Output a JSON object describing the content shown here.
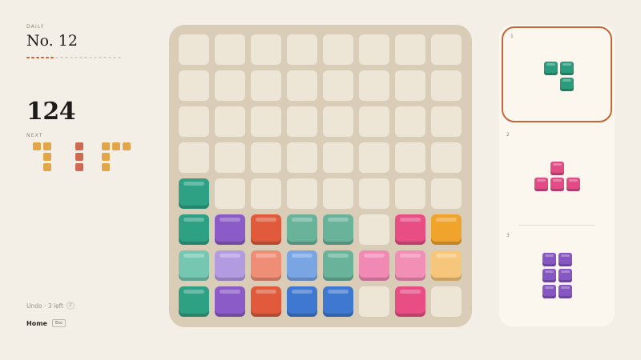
{
  "header": {
    "daily_label": "DAILY",
    "puzzle_title": "No. 12",
    "progress": {
      "filled": 6,
      "total": 20,
      "filled_color": "#d0623a",
      "empty_color": "#dcd3c7"
    }
  },
  "score": "124",
  "next": {
    "label": "NEXT",
    "pieces": [
      {
        "color": "#e2a548",
        "cells": [
          [
            0,
            0
          ],
          [
            1,
            0
          ],
          [
            1,
            1
          ],
          [
            1,
            2
          ]
        ]
      },
      {
        "color": "#cf6a52",
        "cells": [
          [
            0,
            0
          ],
          [
            0,
            1
          ],
          [
            0,
            2
          ]
        ]
      },
      {
        "color": "#e2a548",
        "cells": [
          [
            0,
            0
          ],
          [
            1,
            0
          ],
          [
            2,
            0
          ],
          [
            0,
            1
          ],
          [
            0,
            2
          ]
        ]
      }
    ]
  },
  "undo": {
    "label": "Undo · 3 left",
    "key": "Z"
  },
  "home": {
    "label": "Home",
    "key": "Esc"
  },
  "colors": {
    "teal": "#2ea184",
    "purple": "#8b5bc7",
    "red": "#e05a3b",
    "green_muted": "#6ab39b",
    "pink": "#e84d84",
    "orange": "#f0a42c",
    "teal_light": "#76c7b1",
    "purple_light": "#b39be0",
    "salmon": "#ee8e76",
    "blue_light": "#7aa5e3",
    "pink_light": "#f089b3",
    "pink_soft": "#f28fb5",
    "orange_light": "#f6c67c",
    "blue": "#3e78d1",
    "tray_teal": "#2a9b7d",
    "tray_pink": "#e24b86",
    "tray_purple": "#8656c2",
    "accent": "#c4663a"
  },
  "board": {
    "rows": [
      [
        "empty",
        "empty",
        "empty",
        "empty",
        "empty",
        "empty",
        "empty",
        "empty"
      ],
      [
        "empty",
        "empty",
        "empty",
        "empty",
        "empty",
        "empty",
        "empty",
        "empty"
      ],
      [
        "empty",
        "empty",
        "empty",
        "empty",
        "empty",
        "empty",
        "empty",
        "empty"
      ],
      [
        "empty",
        "empty",
        "empty",
        "empty",
        "empty",
        "empty",
        "empty",
        "empty"
      ],
      [
        "teal",
        "empty",
        "empty",
        "empty",
        "empty",
        "empty",
        "empty",
        "empty"
      ],
      [
        "teal",
        "purple",
        "red",
        "green_muted",
        "green_muted",
        "empty",
        "pink",
        "orange"
      ],
      [
        "teal_light",
        "purple_light",
        "salmon",
        "blue_light",
        "green_muted",
        "pink_light",
        "pink_soft",
        "orange_light"
      ],
      [
        "teal",
        "purple",
        "red",
        "blue",
        "blue",
        "empty",
        "pink",
        "empty"
      ]
    ]
  },
  "tray": {
    "slots": [
      {
        "number": "1",
        "selected": true,
        "color": "tray_teal",
        "cells": [
          [
            0,
            0
          ],
          [
            1,
            0
          ],
          [
            1,
            1
          ]
        ]
      },
      {
        "number": "2",
        "selected": false,
        "color": "tray_pink",
        "cells": [
          [
            1,
            0
          ],
          [
            0,
            1
          ],
          [
            1,
            1
          ],
          [
            2,
            1
          ]
        ]
      },
      {
        "number": "3",
        "selected": false,
        "color": "tray_purple",
        "cells": [
          [
            0,
            0
          ],
          [
            1,
            0
          ],
          [
            0,
            1
          ],
          [
            1,
            1
          ],
          [
            0,
            2
          ],
          [
            1,
            2
          ]
        ]
      }
    ]
  }
}
